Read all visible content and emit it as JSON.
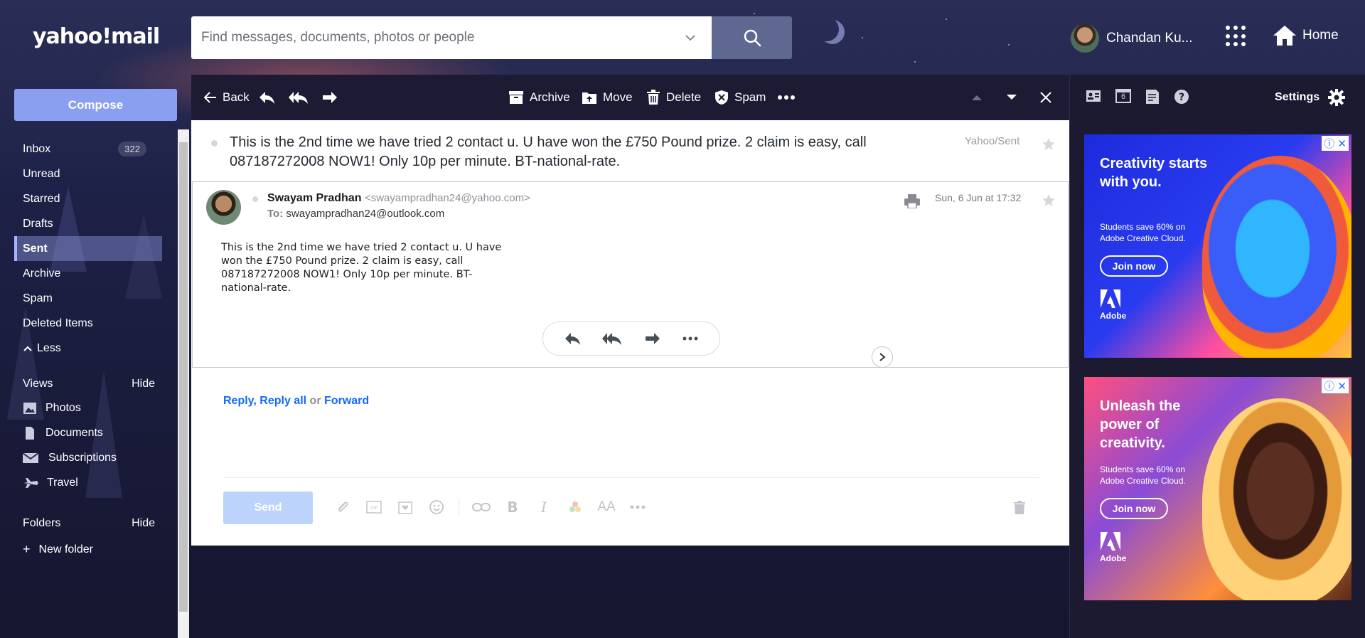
{
  "header": {
    "logo": "yahoo!mail",
    "search_placeholder": "Find messages, documents, photos or people",
    "user_name": "Chandan Ku...",
    "home_label": "Home"
  },
  "sidebar": {
    "compose_label": "Compose",
    "folders": [
      {
        "label": "Inbox",
        "count": "322"
      },
      {
        "label": "Unread"
      },
      {
        "label": "Starred"
      },
      {
        "label": "Drafts"
      },
      {
        "label": "Sent",
        "active": true
      },
      {
        "label": "Archive"
      },
      {
        "label": "Spam"
      },
      {
        "label": "Deleted Items"
      },
      {
        "label": "Less"
      }
    ],
    "views_label": "Views",
    "views_hide": "Hide",
    "views": [
      "Photos",
      "Documents",
      "Subscriptions",
      "Travel"
    ],
    "folders_label": "Folders",
    "folders_hide": "Hide",
    "new_folder": "New folder"
  },
  "toolbar": {
    "back": "Back",
    "archive": "Archive",
    "move": "Move",
    "delete": "Delete",
    "spam": "Spam"
  },
  "message": {
    "subject": "This is the 2nd time we have tried 2 contact u. U have won the £750 Pound prize. 2 claim is easy, call 087187272008 NOW1! Only 10p per minute. BT-national-rate.",
    "folder_tag": "Yahoo/Sent",
    "sender_name": "Swayam Pradhan",
    "sender_email": "<swayampradhan24@yahoo.com>",
    "to_label": "To:",
    "to_address": "swayampradhan24@outlook.com",
    "date": "Sun, 6 Jun at 17:32",
    "body": "This is the 2nd time we have tried 2 contact u. U have won the £750 Pound prize. 2 claim is easy, call 087187272008 NOW1! Only 10p per minute. BT-national-rate."
  },
  "reply": {
    "reply": "Reply",
    "comma": ", ",
    "reply_all": "Reply all",
    "or": " or ",
    "forward": "Forward",
    "send": "Send"
  },
  "rail": {
    "settings": "Settings",
    "calendar_day": "6"
  },
  "ads": [
    {
      "headline": "Creativity starts with you.",
      "sub": "Students save 60% on Adobe Creative Cloud.",
      "cta": "Join now",
      "brand": "Adobe"
    },
    {
      "headline": "Unleash the power of creativity.",
      "sub": "Students save 60% on Adobe Creative Cloud.",
      "cta": "Join now",
      "brand": "Adobe"
    }
  ],
  "colors": {
    "accent": "#0f69ff",
    "compose": "#8a9ff0",
    "toolbar_bg": "#1d1b33"
  }
}
